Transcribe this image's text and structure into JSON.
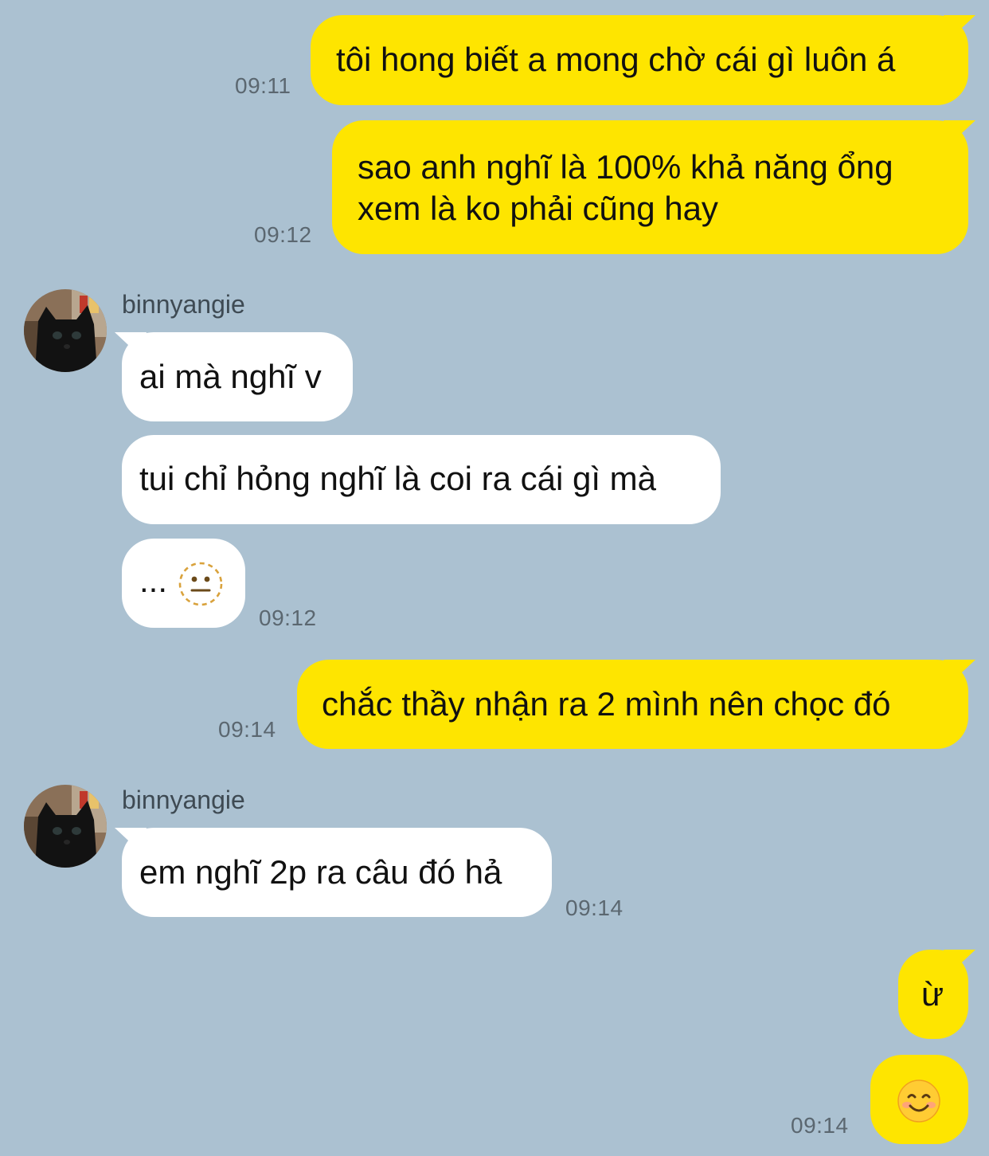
{
  "conversation": {
    "messages": [
      {
        "side": "sent",
        "text": "tôi hong biết a mong chờ cái gì luôn á",
        "time": "09:11"
      },
      {
        "side": "sent",
        "lines": [
          "sao anh nghĩ là 100% khả năng ổng",
          "xem là ko phải cũng hay"
        ],
        "time": "09:12"
      },
      {
        "side": "received",
        "sender": "binnyangie",
        "text": "ai mà nghĩ v"
      },
      {
        "side": "received",
        "text": "tui chỉ hỏng nghĩ là coi ra cái gì mà"
      },
      {
        "side": "received",
        "text": "...",
        "emoji": "neutral-face-dotted-icon",
        "time": "09:12"
      },
      {
        "side": "sent",
        "text": "chắc thầy nhận ra 2 mình nên chọc đó",
        "time": "09:14"
      },
      {
        "side": "received",
        "sender": "binnyangie",
        "text": "em nghĩ 2p ra câu đó hả",
        "time": "09:14"
      },
      {
        "side": "sent",
        "text": "ừ"
      },
      {
        "side": "sent",
        "emoji": "smiling-face-icon",
        "time": "09:14"
      }
    ]
  },
  "colors": {
    "background": "#abc1d1",
    "sent_bubble": "#fee500",
    "received_bubble": "#ffffff",
    "timestamp": "#5b6770"
  },
  "avatar": "black-cat-avatar-icon"
}
